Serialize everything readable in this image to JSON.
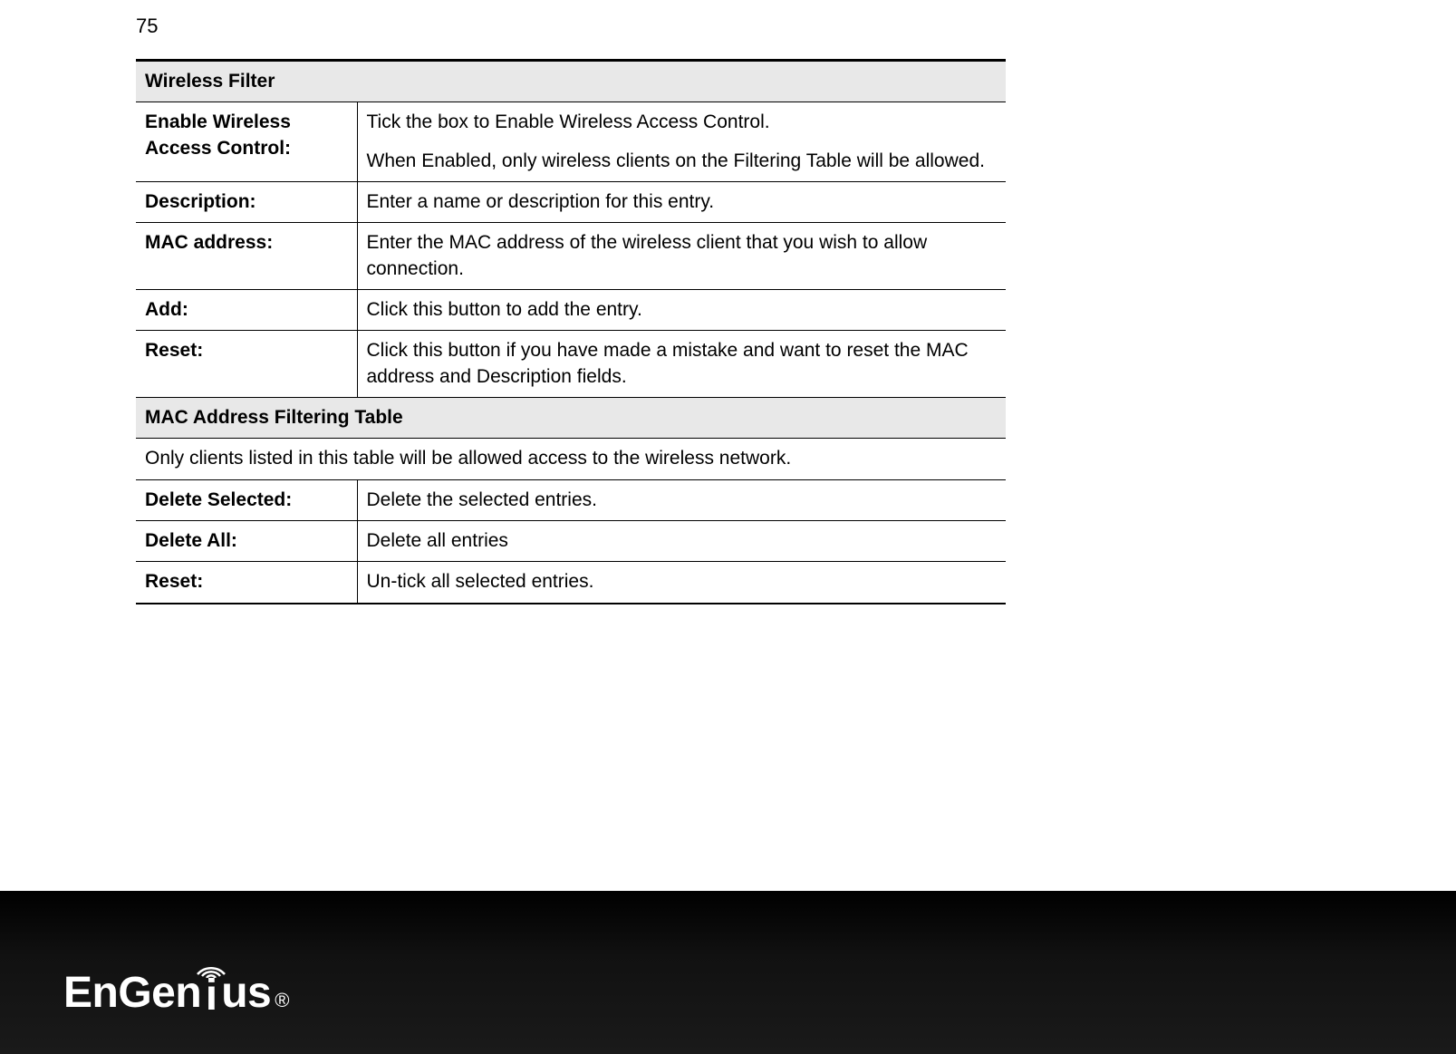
{
  "page_number": "75",
  "logo_text_parts": {
    "en": "EnGen",
    "i": "i",
    "us": "us"
  },
  "registered_mark": "®",
  "table": {
    "section1_header": "Wireless Filter",
    "rows1": [
      {
        "label": "Enable Wireless Access Control:",
        "desc_line1": "Tick the box to Enable Wireless Access Control.",
        "desc_line2": "When Enabled, only wireless clients on the Filtering Table will be allowed."
      },
      {
        "label": "Description:",
        "desc": "Enter a name or description for this entry."
      },
      {
        "label": "MAC address:",
        "desc": "Enter the MAC address of the wireless client that you wish to allow connection."
      },
      {
        "label": "Add:",
        "desc": "Click this button to add the entry."
      },
      {
        "label": "Reset:",
        "desc": "Click this button if you have made a mistake and want to reset the MAC address and Description fields."
      }
    ],
    "section2_header": "MAC Address Filtering Table",
    "section2_note": "Only clients listed in this table will be allowed access to the wireless network.",
    "rows2": [
      {
        "label": "Delete Selected:",
        "desc": "Delete the selected entries."
      },
      {
        "label": "Delete All:",
        "desc": "Delete all entries"
      },
      {
        "label": "Reset:",
        "desc": "Un-tick all selected entries."
      }
    ]
  }
}
